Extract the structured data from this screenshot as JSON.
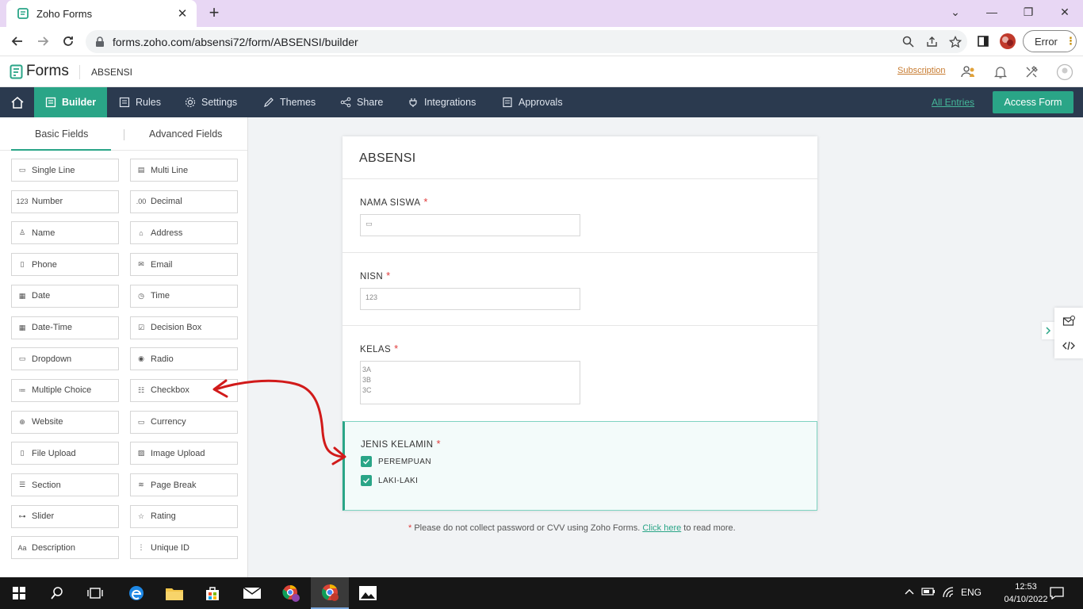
{
  "browser": {
    "tab_title": "Zoho Forms",
    "url": "forms.zoho.com/absensi72/form/ABSENSI/builder",
    "profile_status": "Error"
  },
  "app": {
    "brand": "Forms",
    "form_name": "ABSENSI",
    "subscription_link": "Subscription"
  },
  "nav": {
    "items": [
      {
        "label": "Builder",
        "icon": "builder-icon"
      },
      {
        "label": "Rules",
        "icon": "rules-icon"
      },
      {
        "label": "Settings",
        "icon": "gear-icon"
      },
      {
        "label": "Themes",
        "icon": "brush-icon"
      },
      {
        "label": "Share",
        "icon": "share-icon"
      },
      {
        "label": "Integrations",
        "icon": "plug-icon"
      },
      {
        "label": "Approvals",
        "icon": "approvals-icon"
      }
    ],
    "all_entries": "All Entries",
    "access_form": "Access Form"
  },
  "field_panel": {
    "tabs": [
      "Basic Fields",
      "Advanced Fields"
    ],
    "fields": [
      {
        "label": "Single Line",
        "glyph": "▭"
      },
      {
        "label": "Multi Line",
        "glyph": "▤"
      },
      {
        "label": "Number",
        "glyph": "123"
      },
      {
        "label": "Decimal",
        "glyph": ".00"
      },
      {
        "label": "Name",
        "glyph": "♙"
      },
      {
        "label": "Address",
        "glyph": "⌂"
      },
      {
        "label": "Phone",
        "glyph": "▯"
      },
      {
        "label": "Email",
        "glyph": "✉"
      },
      {
        "label": "Date",
        "glyph": "▦"
      },
      {
        "label": "Time",
        "glyph": "◷"
      },
      {
        "label": "Date-Time",
        "glyph": "▦"
      },
      {
        "label": "Decision Box",
        "glyph": "☑"
      },
      {
        "label": "Dropdown",
        "glyph": "▭"
      },
      {
        "label": "Radio",
        "glyph": "◉"
      },
      {
        "label": "Multiple Choice",
        "glyph": "≔"
      },
      {
        "label": "Checkbox",
        "glyph": "☷"
      },
      {
        "label": "Website",
        "glyph": "⊕"
      },
      {
        "label": "Currency",
        "glyph": "▭"
      },
      {
        "label": "File Upload",
        "glyph": "▯"
      },
      {
        "label": "Image Upload",
        "glyph": "▨"
      },
      {
        "label": "Section",
        "glyph": "☰"
      },
      {
        "label": "Page Break",
        "glyph": "≋"
      },
      {
        "label": "Slider",
        "glyph": "⊶"
      },
      {
        "label": "Rating",
        "glyph": "☆"
      },
      {
        "label": "Description",
        "glyph": "Aa"
      },
      {
        "label": "Unique ID",
        "glyph": "⋮"
      }
    ]
  },
  "form": {
    "title": "ABSENSI",
    "fields": {
      "nama_siswa": {
        "label": "NAMA SISWA",
        "placeholder_glyph": "▭"
      },
      "nisn": {
        "label": "NISN",
        "placeholder_glyph": "123"
      },
      "kelas": {
        "label": "KELAS",
        "options": [
          "3A",
          "3B",
          "3C"
        ]
      },
      "jenis_kelamin": {
        "label": "JENIS KELAMIN",
        "options": [
          "PEREMPUAN",
          "LAKI-LAKI"
        ]
      }
    },
    "required_marker": "*"
  },
  "footer_note": {
    "star": "*",
    "text": "Please do not collect password or CVV using Zoho Forms.",
    "link": "Click here",
    "tail": "to read more."
  },
  "taskbar": {
    "lang": "ENG",
    "time": "12:53",
    "date": "04/10/2022"
  },
  "colors": {
    "accent": "#2aa587",
    "navbar": "#2b3a4f",
    "annotation_arrow": "#d11a1a"
  }
}
